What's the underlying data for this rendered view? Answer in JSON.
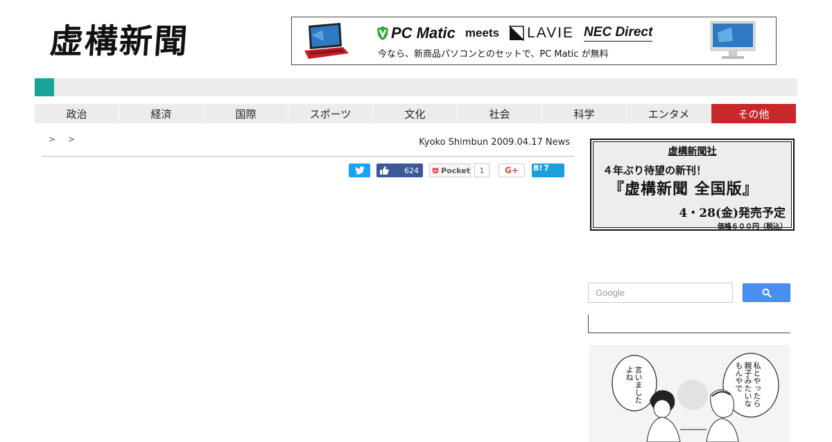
{
  "site": {
    "logo_text": "虚構新聞"
  },
  "banner": {
    "brand1": "PC Matic",
    "meets": "meets",
    "brand2": "LAVIE",
    "brand3": "NEC Direct",
    "copy": "今なら、新商品パソコンとのセットで、PC Matic が無料"
  },
  "nav": {
    "items": [
      {
        "label": "政治"
      },
      {
        "label": "経済"
      },
      {
        "label": "国際"
      },
      {
        "label": "スポーツ"
      },
      {
        "label": "文化"
      },
      {
        "label": "社会"
      },
      {
        "label": "科学"
      },
      {
        "label": "エンタメ"
      },
      {
        "label": "その他"
      }
    ]
  },
  "article": {
    "breadcrumb_sep": ">",
    "byline": "Kyoko Shimbun 2009.04.17 News"
  },
  "share": {
    "facebook_count": "624",
    "pocket_label": "Pocket",
    "pocket_count": "1",
    "gplus_label": "G+",
    "hatena_label": "B!",
    "hatena_count": "7"
  },
  "ad": {
    "publisher": "虚構新聞社",
    "line1": "４年ぶり待望の新刊！",
    "title": "『虚構新聞 全国版』",
    "release": "4・28(金)発売予定",
    "price": "価格６００円（税込）"
  },
  "search": {
    "placeholder": "Google"
  },
  "manga": {
    "bubble_left": "言いました よね",
    "bubble_right": "私とやったら 親子みたいな もんやで"
  },
  "colors": {
    "accent_teal": "#18a497",
    "nav_highlight": "#c8282a",
    "twitter": "#1da1f2",
    "facebook": "#3b5998",
    "hatena": "#1ba0dd",
    "search_button": "#4a8ef0"
  }
}
